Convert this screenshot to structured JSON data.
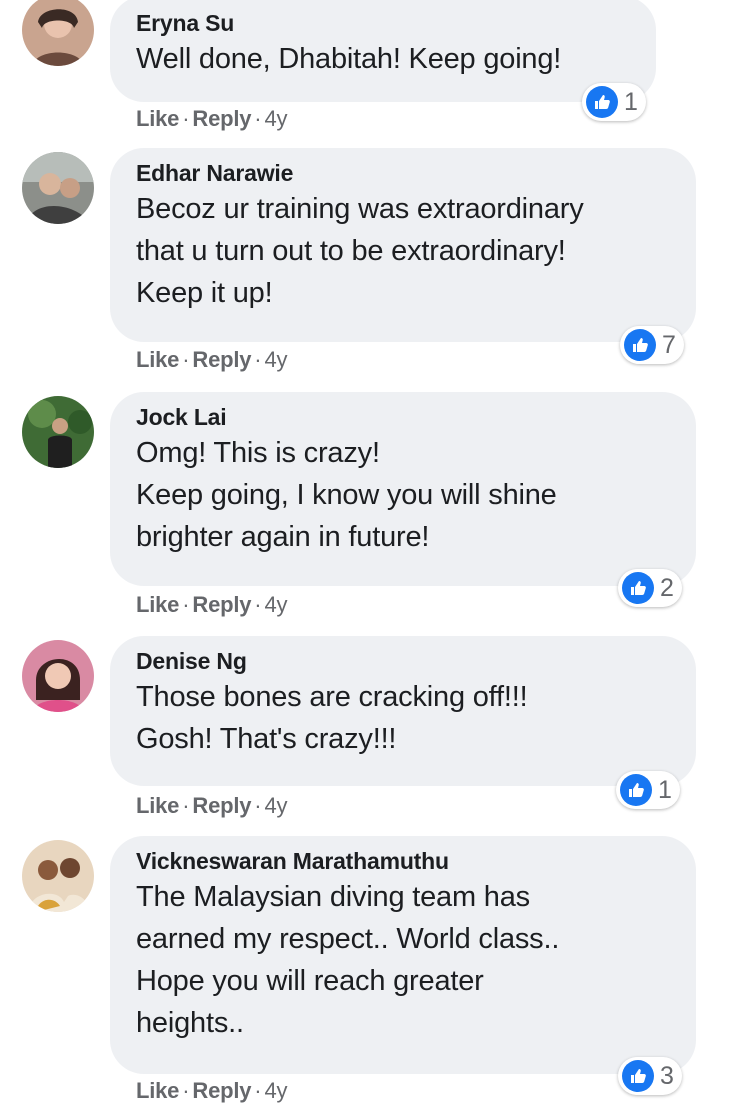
{
  "comments": [
    {
      "author": "Eryna Su",
      "text": "Well done, Dhabitah! Keep going!",
      "like_label": "Like",
      "reply_label": "Reply",
      "age": "4y",
      "reaction_count": "1",
      "reaction_icon": "like-icon"
    },
    {
      "author": "Edhar Narawie",
      "text": "Becoz ur training was extraordinary\nthat u turn out to be extraordinary!\nKeep it up!",
      "like_label": "Like",
      "reply_label": "Reply",
      "age": "4y",
      "reaction_count": "7",
      "reaction_icon": "like-icon"
    },
    {
      "author": "Jock Lai",
      "text": "Omg! This is crazy!\nKeep going, I know you will shine\nbrighter again in future!",
      "like_label": "Like",
      "reply_label": "Reply",
      "age": "4y",
      "reaction_count": "2",
      "reaction_icon": "like-icon"
    },
    {
      "author": "Denise Ng",
      "text": "Those bones are cracking off!!!\nGosh! That's crazy!!!",
      "like_label": "Like",
      "reply_label": "Reply",
      "age": "4y",
      "reaction_count": "1",
      "reaction_icon": "like-icon"
    },
    {
      "author": "Vickneswaran Marathamuthu",
      "text": "The Malaysian diving team has\nearned my respect.. World class..\nHope you will reach greater\nheights..",
      "like_label": "Like",
      "reply_label": "Reply",
      "age": "4y",
      "reaction_count": "3",
      "reaction_icon": "like-icon"
    }
  ],
  "separator": "·",
  "colors": {
    "bubble_bg": "#eef0f3",
    "text": "#1c1e21",
    "meta": "#65676b",
    "like_blue": "#1877f2"
  }
}
